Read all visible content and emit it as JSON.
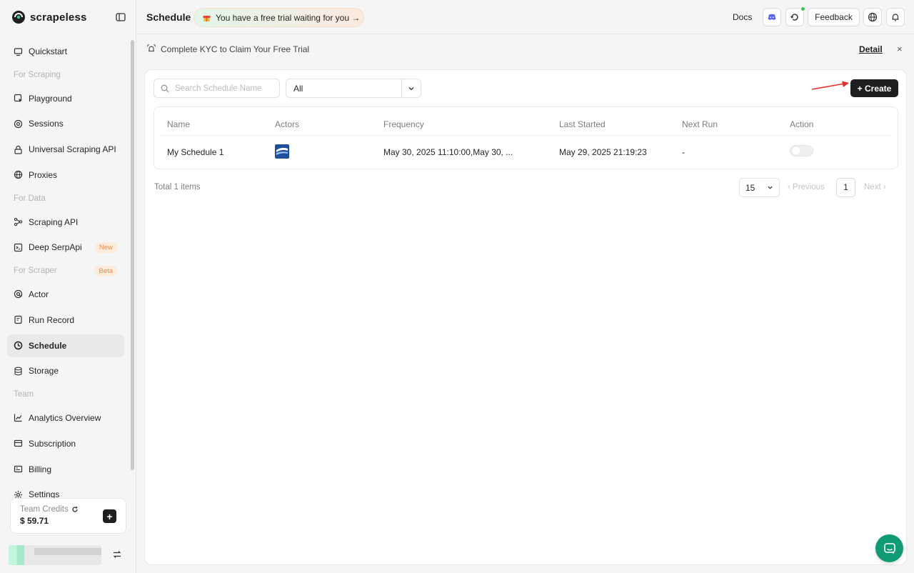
{
  "brand": {
    "name": "scrapeless"
  },
  "sidebar": {
    "items": [
      {
        "type": "item",
        "label": "Quickstart",
        "icon": "monitor-icon"
      },
      {
        "type": "section",
        "label": "For Scraping"
      },
      {
        "type": "item",
        "label": "Playground",
        "icon": "cursor-square-icon"
      },
      {
        "type": "item",
        "label": "Sessions",
        "icon": "target-icon"
      },
      {
        "type": "item",
        "label": "Universal Scraping API",
        "icon": "lock-icon"
      },
      {
        "type": "item",
        "label": "Proxies",
        "icon": "globe-icon"
      },
      {
        "type": "section",
        "label": "For Data"
      },
      {
        "type": "item",
        "label": "Scraping API",
        "icon": "nodes-icon"
      },
      {
        "type": "item",
        "label": "Deep SerpApi",
        "icon": "terminal-icon",
        "badge": "New"
      },
      {
        "type": "section",
        "label": "For Scraper",
        "badge": "Beta"
      },
      {
        "type": "item",
        "label": "Actor",
        "icon": "at-icon"
      },
      {
        "type": "item",
        "label": "Run Record",
        "icon": "record-icon"
      },
      {
        "type": "item",
        "label": "Schedule",
        "icon": "clock-icon",
        "active": true
      },
      {
        "type": "item",
        "label": "Storage",
        "icon": "database-icon"
      },
      {
        "type": "section",
        "label": "Team"
      },
      {
        "type": "item",
        "label": "Analytics Overview",
        "icon": "chart-icon"
      },
      {
        "type": "item",
        "label": "Subscription",
        "icon": "card-icon"
      },
      {
        "type": "item",
        "label": "Billing",
        "icon": "receipt-icon"
      },
      {
        "type": "item",
        "label": "Settings",
        "icon": "gear-icon"
      }
    ],
    "credits": {
      "label": "Team Credits",
      "value": "$ 59.71"
    }
  },
  "topbar": {
    "title": "Schedule",
    "trial": "You have a free trial waiting for you →",
    "docs": "Docs",
    "feedback": "Feedback"
  },
  "kyc": {
    "text": "Complete KYC to Claim Your Free Trial",
    "detail": "Detail",
    "close": "×"
  },
  "toolbar": {
    "search_placeholder": "Search Schedule Name",
    "filter_value": "All",
    "create_label": "+ Create"
  },
  "table": {
    "columns": [
      "Name",
      "Actors",
      "Frequency",
      "Last Started",
      "Next Run",
      "Action"
    ],
    "rows": [
      {
        "name": "My Schedule 1",
        "actor_icon": "actor-logo-icon",
        "frequency": "May 30, 2025 11:10:00,May 30, ...",
        "last_started": "May 29, 2025 21:19:23",
        "next_run": "-",
        "enabled": false
      }
    ]
  },
  "pagination": {
    "total": "Total 1 items",
    "page_size": "15",
    "previous": "‹ Previous",
    "current": "1",
    "next": "Next ›"
  },
  "colors": {
    "accent": "#1f1f1f",
    "chat": "#0f9b74",
    "annotation": "#e8302a"
  }
}
